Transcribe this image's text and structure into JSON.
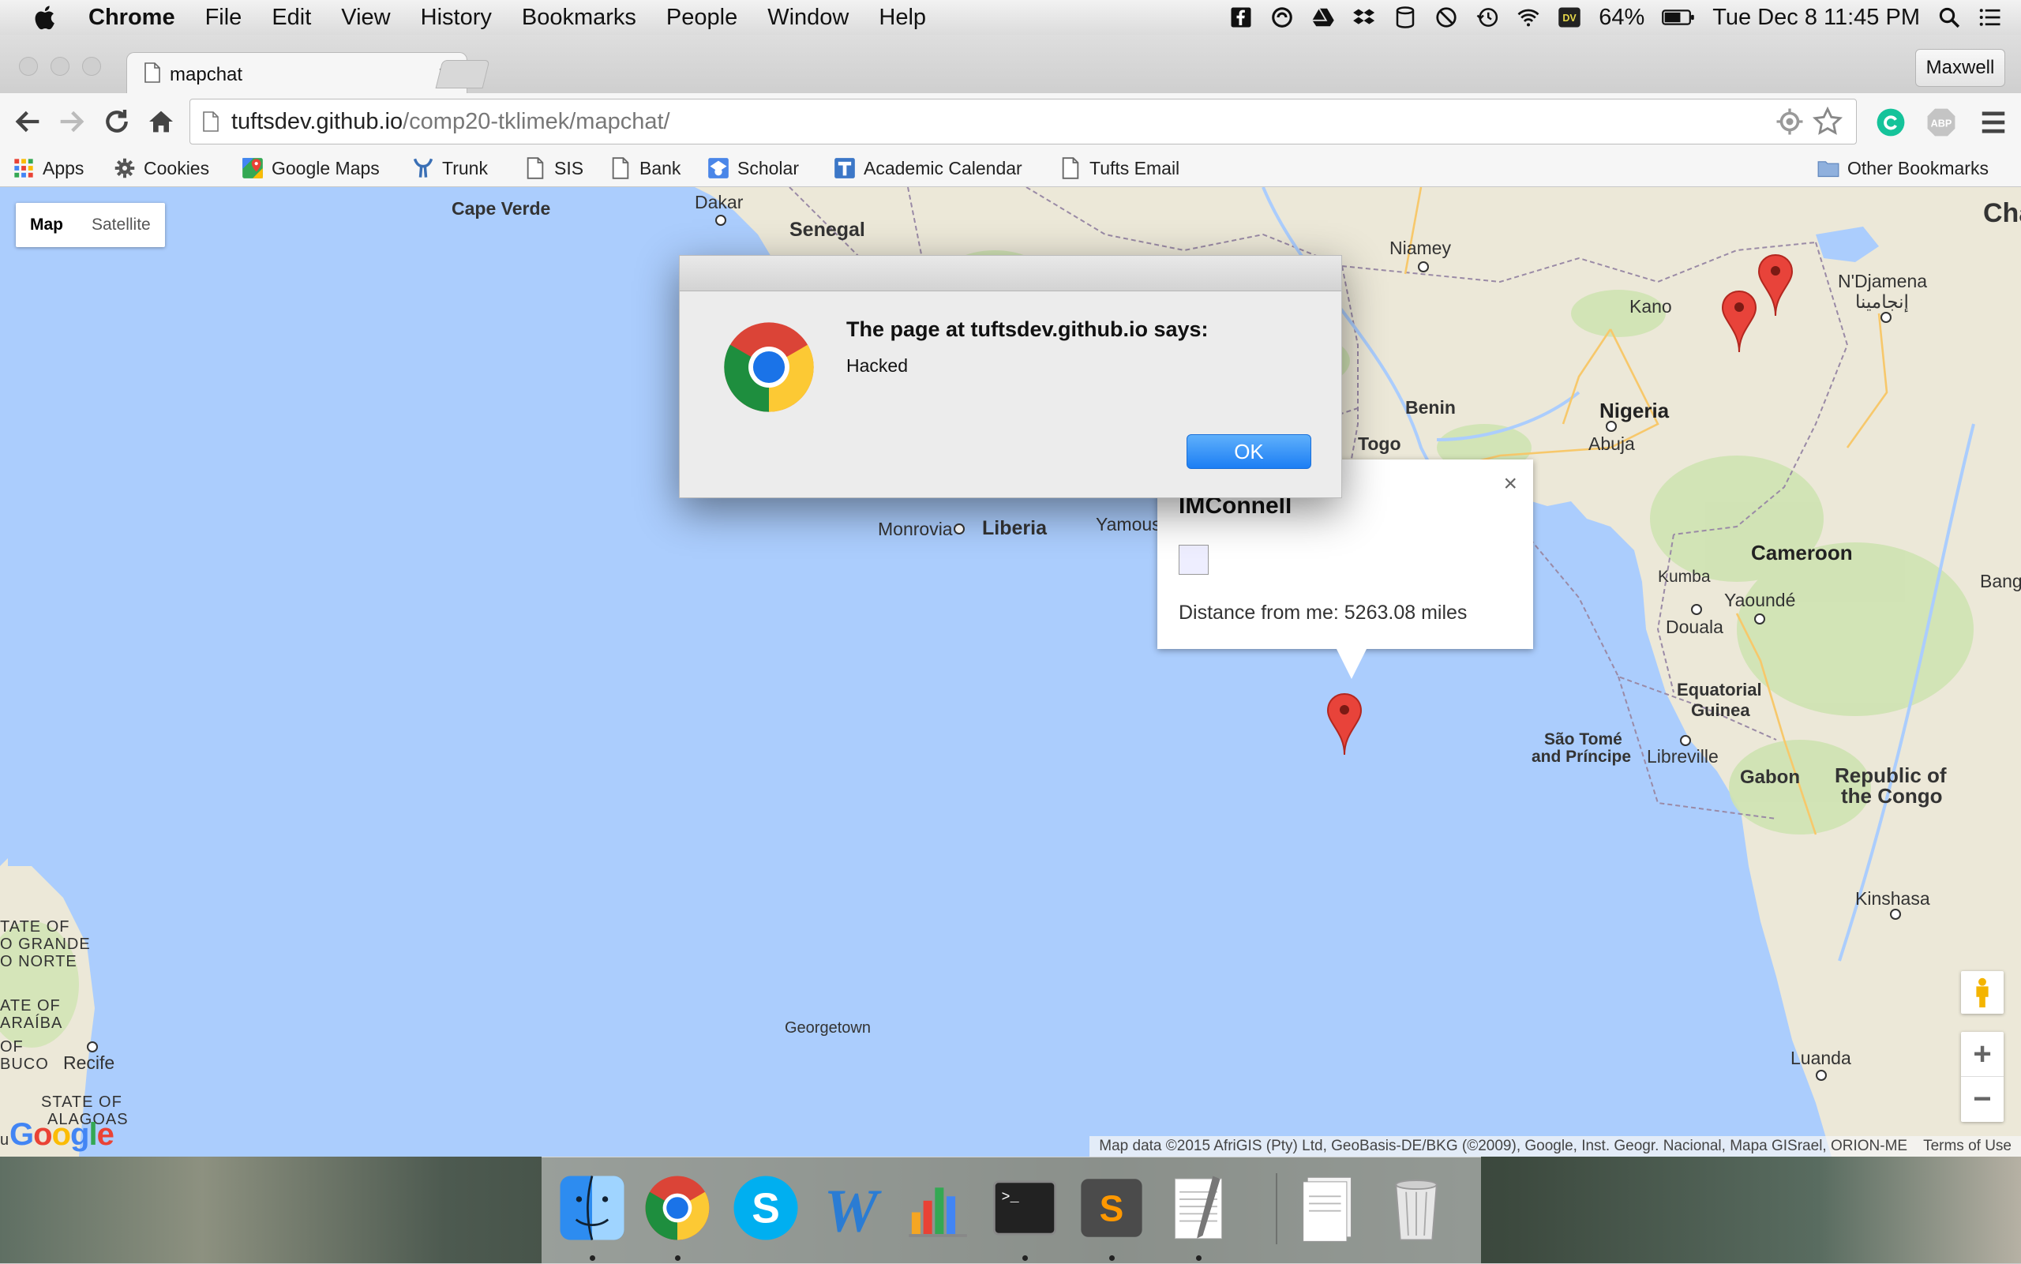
{
  "menubar": {
    "app_name": "Chrome",
    "menus": [
      "File",
      "Edit",
      "View",
      "History",
      "Bookmarks",
      "People",
      "Window",
      "Help"
    ],
    "battery": "64%",
    "datetime": "Tue Dec 8  11:45 PM",
    "status_icons": [
      "facebook-icon",
      "sync-icon",
      "drive-icon",
      "dropbox-icon",
      "database-icon",
      "circle-slash-icon",
      "time-machine-icon",
      "wifi-icon",
      "dv-icon",
      "battery-icon",
      "spotlight-icon",
      "notification-list-icon"
    ]
  },
  "browser": {
    "tab_title": "mapchat",
    "profile_name": "Maxwell",
    "url_host": "tuftsdev.github.io",
    "url_path": "/comp20-tklimek/mapchat/"
  },
  "bookmarks": [
    {
      "label": "Apps",
      "icon": "apps-grid-icon"
    },
    {
      "label": "Cookies",
      "icon": "gear-icon"
    },
    {
      "label": "Google Maps",
      "icon": "maps-icon"
    },
    {
      "label": "Trunk",
      "icon": "trunk-icon"
    },
    {
      "label": "SIS",
      "icon": "page-icon"
    },
    {
      "label": "Bank",
      "icon": "page-icon"
    },
    {
      "label": "Scholar",
      "icon": "scholar-icon"
    },
    {
      "label": "Academic Calendar",
      "icon": "calendar-icon"
    },
    {
      "label": "Tufts Email",
      "icon": "page-icon"
    }
  ],
  "other_bookmarks": "Other Bookmarks",
  "map": {
    "type_controls": {
      "map": "Map",
      "satellite": "Satellite"
    },
    "labels": {
      "cape_verde": "Cape Verde",
      "dakar": "Dakar",
      "senegal": "Senegal",
      "niamey": "Niamey",
      "kano": "Kano",
      "ndjamena": "N'Djamena",
      "ndjamena_ar": "إنجامينا",
      "benin": "Benin",
      "nigeria": "Nigeria",
      "abuja": "Abuja",
      "togo": "Togo",
      "monrovia": "Monrovia",
      "liberia": "Liberia",
      "yamous": "Yamous",
      "kumba": "Kumba",
      "cameroon": "Cameroon",
      "yaounde": "Yaoundé",
      "douala": "Douala",
      "eq_guinea_1": "Equatorial",
      "eq_guinea_2": "Guinea",
      "sao_tome_1": "São Tomé",
      "sao_tome_2": "and Príncipe",
      "libreville": "Libreville",
      "gabon": "Gabon",
      "congo_1": "Republic of",
      "congo_2": "the Congo",
      "kinshasa": "Kinshasa",
      "luanda": "Luanda",
      "georgetown": "Georgetown",
      "recife": "Recife",
      "rn_1": "TATE OF",
      "rn_2": "O GRANDE",
      "rn_3": "O NORTE",
      "pb_1": "ATE OF",
      "pb_2": "ARAÍBA",
      "pb_3": "OF",
      "pe": "BUCO",
      "al_1": "STATE OF",
      "al_2": "ALAGOAS",
      "cha": "Cha",
      "bang": "Bang",
      "edge_u": "u"
    },
    "google_logo": "Google",
    "attribution": "Map data ©2015 AfriGIS (Pty) Ltd, GeoBasis-DE/BKG (©2009), Google, Inst. Geogr. Nacional, Mapa GISrael, ORION-ME",
    "terms": "Terms of Use",
    "info_window": {
      "name": "IMConnell",
      "distance": "Distance from me: 5263.08 miles"
    },
    "markers": 3
  },
  "dialog": {
    "heading": "The page at tuftsdev.github.io says:",
    "message": "Hacked",
    "ok_label": "OK"
  },
  "dock": {
    "apps": [
      "finder-icon",
      "chrome-icon",
      "skype-icon",
      "word-icon",
      "numbers-icon",
      "terminal-icon",
      "sublime-icon",
      "textedit-icon",
      "documents-icon",
      "trash-icon"
    ]
  },
  "colors": {
    "ocean": "#abcdfd",
    "land": "#ece8d8",
    "marker": "#e8433a",
    "dialog_button": "#1c7ef4"
  }
}
